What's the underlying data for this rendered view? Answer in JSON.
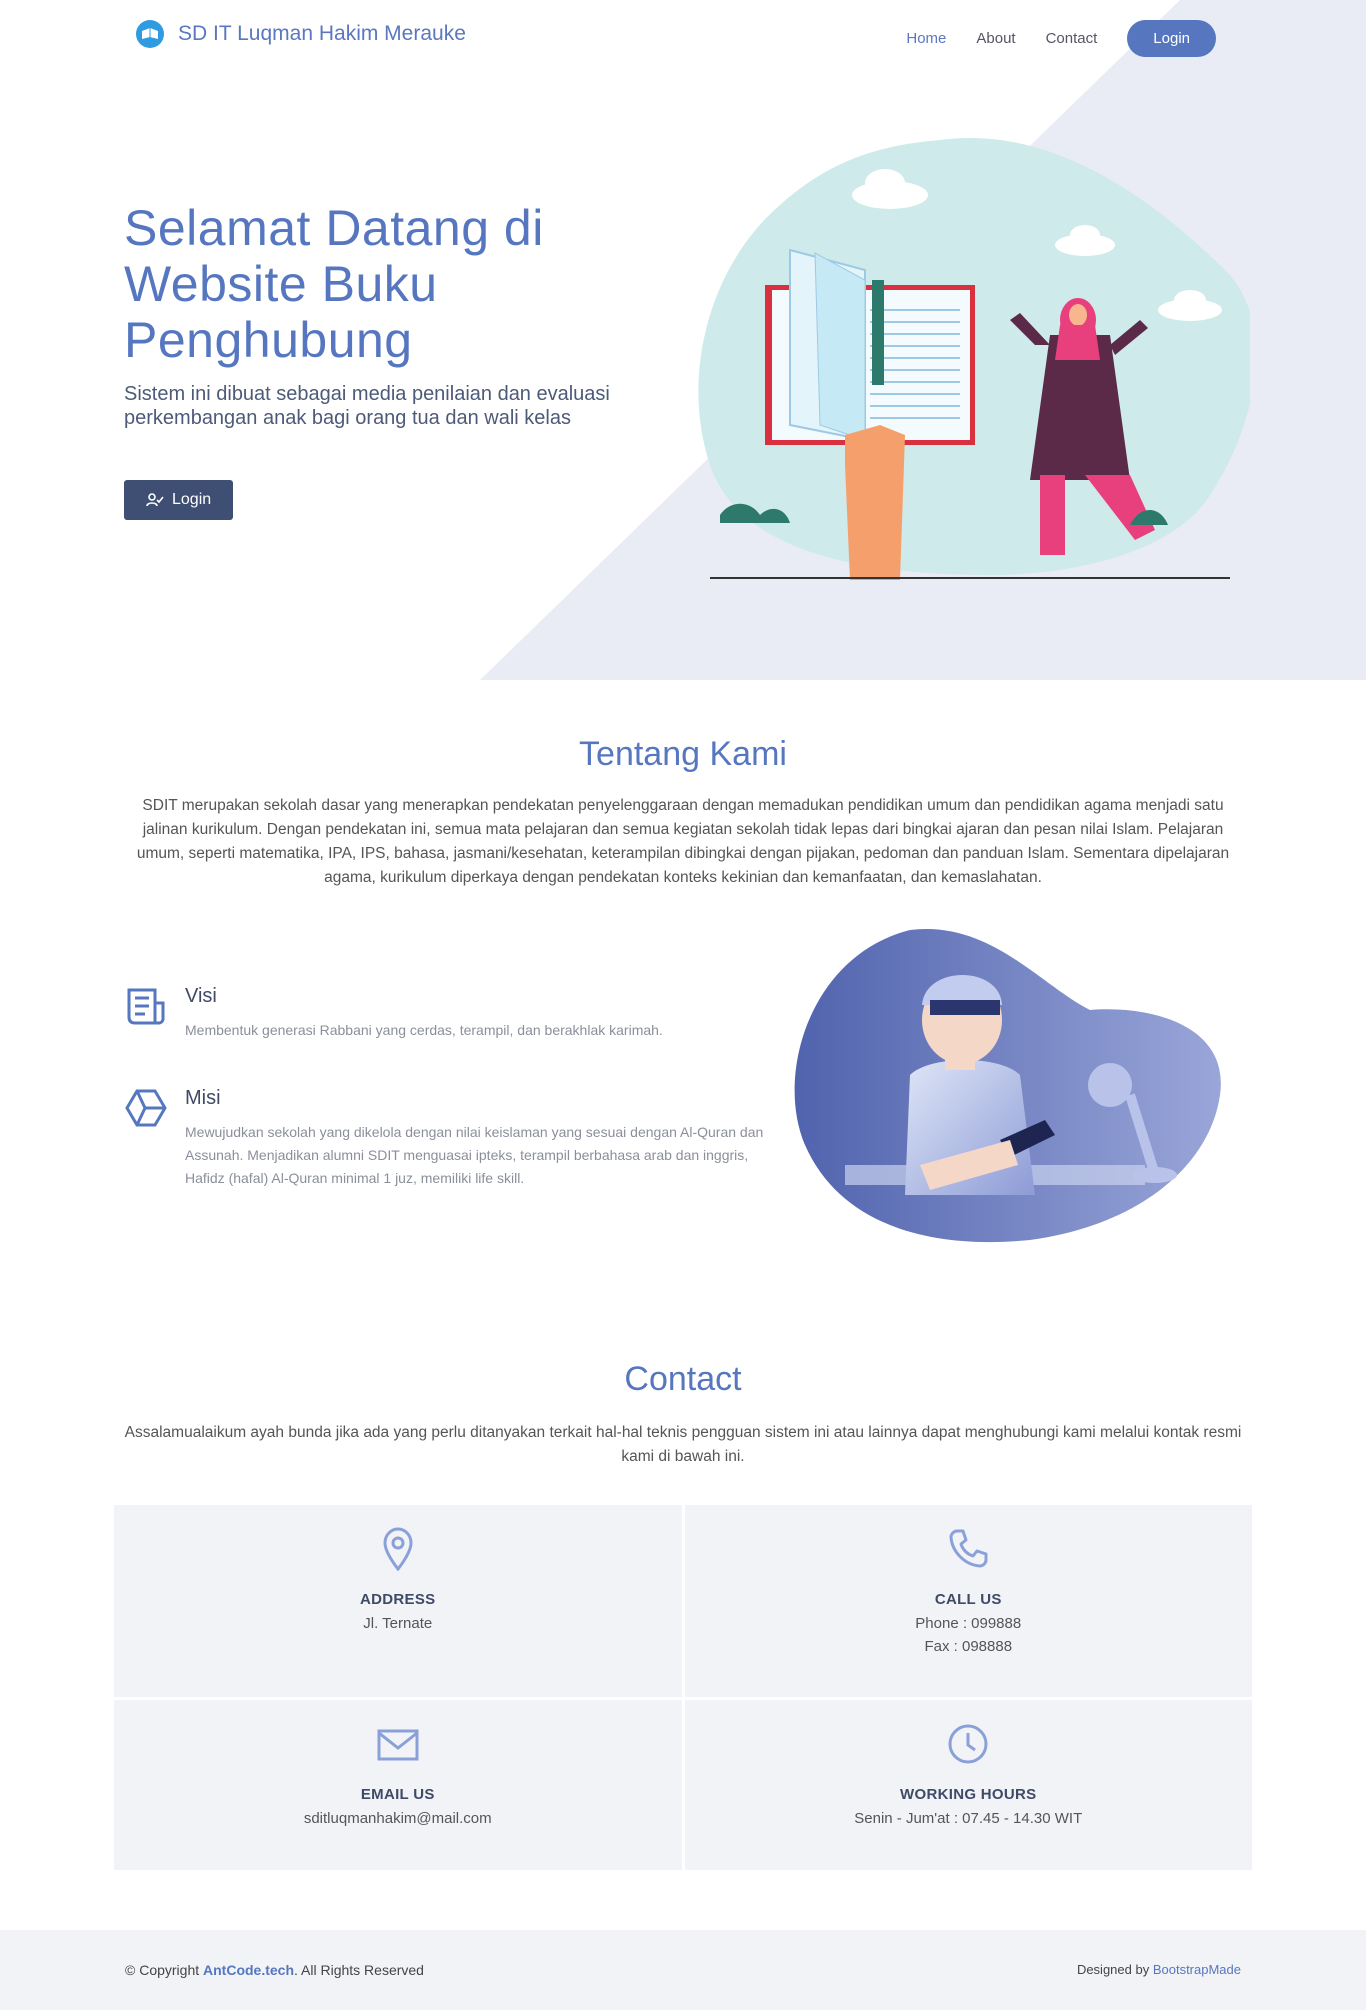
{
  "header": {
    "brand": "SD IT Luqman Hakim Merauke",
    "nav": [
      {
        "label": "Home"
      },
      {
        "label": "About"
      },
      {
        "label": "Contact"
      }
    ],
    "login_label": "Login"
  },
  "hero": {
    "title": "Selamat Datang di Website Buku Penghubung",
    "subtitle": "Sistem ini dibuat sebagai media penilaian dan evaluasi perkembangan anak bagi orang tua dan wali kelas",
    "button_label": "Login"
  },
  "about": {
    "title": "Tentang Kami",
    "description": "SDIT merupakan sekolah dasar yang menerapkan pendekatan penyelenggaraan dengan memadukan pendidikan umum dan pendidikan agama menjadi satu jalinan kurikulum. Dengan pendekatan ini, semua mata pelajaran dan semua kegiatan sekolah tidak lepas dari bingkai ajaran dan pesan nilai Islam. Pelajaran umum, seperti matematika, IPA, IPS, bahasa, jasmani/kesehatan, keterampilan dibingkai dengan pijakan, pedoman dan panduan Islam. Sementara dipelajaran agama, kurikulum diperkaya dengan pendekatan konteks kekinian dan kemanfaatan, dan kemaslahatan.",
    "visi": {
      "title": "Visi",
      "text": "Membentuk generasi Rabbani yang cerdas, terampil, dan berakhlak karimah."
    },
    "misi": {
      "title": "Misi",
      "text": "Mewujudkan sekolah yang dikelola dengan nilai keislaman yang sesuai dengan Al-Quran dan Assunah. Menjadikan alumni SDIT menguasai ipteks, terampil berbahasa arab dan inggris, Hafidz (hafal) Al-Quran minimal 1 juz, memiliki life skill."
    }
  },
  "contact": {
    "title": "Contact",
    "description": "Assalamualaikum ayah bunda jika ada yang perlu ditanyakan terkait hal-hal teknis pengguan sistem ini atau lainnya dapat menghubungi kami melalui kontak resmi kami di bawah ini.",
    "address": {
      "title": "ADDRESS",
      "line": "Jl. Ternate"
    },
    "call": {
      "title": "CALL US",
      "phone": "Phone : 099888",
      "fax": "Fax : 098888"
    },
    "email": {
      "title": "EMAIL US",
      "line": "sditluqmanhakim@mail.com"
    },
    "hours": {
      "title": "WORKING HOURS",
      "line": "Senin - Jum'at : 07.45 - 14.30 WIT"
    }
  },
  "footer": {
    "copyright_prefix": "© Copyright ",
    "copyright_brand": "AntCode.tech",
    "copyright_suffix": ". All Rights Reserved",
    "credits_prefix": "Designed by ",
    "credits_link": "BootstrapMade"
  },
  "colors": {
    "primary": "#5677c0",
    "dark_button": "#3f4f73",
    "hero_triangle": "#e9ecf5",
    "blob_hero": "#cfeaea",
    "blob_about": "#5b6fba",
    "box_bg": "#f1f3f7"
  }
}
